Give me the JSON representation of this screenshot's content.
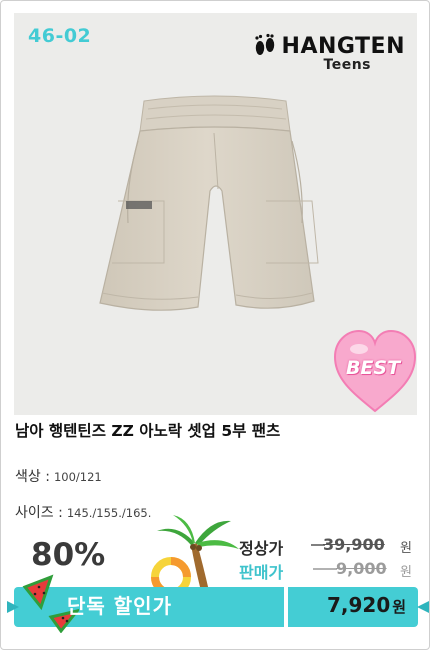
{
  "product_code": "46-02",
  "brand": {
    "name": "HANGTEN",
    "sub": "Teens"
  },
  "badge": "BEST",
  "title": "남아 행텐틴즈 ZZ 아노락 셋업 5부 팬츠",
  "options": {
    "color_label": "색상 :",
    "color_value": "100/121",
    "size_label": "사이즈 :",
    "size_value": "145./155./165."
  },
  "discount": "80%",
  "prices": {
    "regular_label": "정상가",
    "regular_value": "39,900",
    "sale_label": "판매가",
    "sale_value": "9,000",
    "currency": "원"
  },
  "promo": {
    "label": "단독 할인가",
    "price": "7,920",
    "currency": "원"
  },
  "colors": {
    "accent": "#44cdd4",
    "regular_label": "#2b2b2b",
    "sale_label": "#3ec3cc",
    "badge_pink": "#f7a6cb"
  },
  "icons": [
    "footprint-icon",
    "watermelon-icon",
    "palm-tree-icon",
    "swim-ring-icon",
    "heart-icon"
  ]
}
